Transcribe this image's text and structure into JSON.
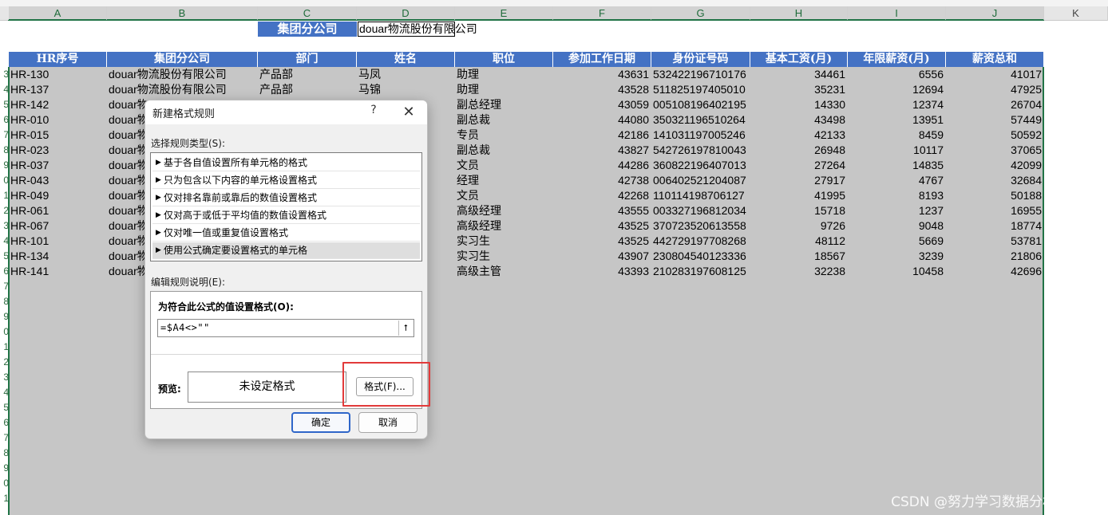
{
  "spreadsheet": {
    "columns": [
      "A",
      "B",
      "C",
      "D",
      "E",
      "F",
      "G",
      "H",
      "I",
      "J",
      "K"
    ],
    "selected_columns": [
      "A",
      "B",
      "C",
      "D",
      "E",
      "F",
      "G",
      "H",
      "I",
      "J"
    ],
    "row_numbers": [
      "3",
      "4",
      "5",
      "6",
      "7",
      "8",
      "9",
      "0",
      "1",
      "2",
      "3",
      "4",
      "5",
      "6",
      "7",
      "8",
      "9",
      "0",
      "1",
      "2",
      "3",
      "4",
      "5",
      "6",
      "7",
      "8",
      "9",
      "0",
      "1"
    ],
    "title_label": "集团分公司",
    "title_value": "douar物流股份有限公司",
    "headers": [
      "HR序号",
      "集团分公司",
      "部门",
      "姓名",
      "职位",
      "参加工作日期",
      "身份证号码",
      "基本工资(月)",
      "年限薪资(月)",
      "薪资总和"
    ],
    "rows": [
      {
        "hr": "HR-130",
        "company": "douar物流股份有限公司",
        "dept": "产品部",
        "name": "马凤",
        "position": "助理",
        "date": "43631",
        "id": "532422196710176",
        "base": "34461",
        "seniority": "6556",
        "total": "41017"
      },
      {
        "hr": "HR-137",
        "company": "douar物流股份有限公司",
        "dept": "产品部",
        "name": "马锦",
        "position": "助理",
        "date": "43528",
        "id": "511825197405010",
        "base": "35231",
        "seniority": "12694",
        "total": "47925"
      },
      {
        "hr": "HR-142",
        "company": "douar物",
        "dept": "",
        "name": "",
        "position": "副总经理",
        "date": "43059",
        "id": "005108196402195",
        "base": "14330",
        "seniority": "12374",
        "total": "26704"
      },
      {
        "hr": "HR-010",
        "company": "douar物",
        "dept": "",
        "name": "",
        "position": "副总裁",
        "date": "44080",
        "id": "350321196510264",
        "base": "43498",
        "seniority": "13951",
        "total": "57449"
      },
      {
        "hr": "HR-015",
        "company": "douar物",
        "dept": "",
        "name": "",
        "position": "专员",
        "date": "42186",
        "id": "141031197005246",
        "base": "42133",
        "seniority": "8459",
        "total": "50592"
      },
      {
        "hr": "HR-023",
        "company": "douar物",
        "dept": "",
        "name": "",
        "position": "副总裁",
        "date": "43827",
        "id": "542726197810043",
        "base": "26948",
        "seniority": "10117",
        "total": "37065"
      },
      {
        "hr": "HR-037",
        "company": "douar物",
        "dept": "",
        "name": "",
        "position": "文员",
        "date": "44286",
        "id": "360822196407013",
        "base": "27264",
        "seniority": "14835",
        "total": "42099"
      },
      {
        "hr": "HR-043",
        "company": "douar物",
        "dept": "",
        "name": "",
        "position": "经理",
        "date": "42738",
        "id": "006402521204087",
        "base": "27917",
        "seniority": "4767",
        "total": "32684"
      },
      {
        "hr": "HR-049",
        "company": "douar物",
        "dept": "",
        "name": "",
        "position": "文员",
        "date": "42268",
        "id": "110114198706127",
        "base": "41995",
        "seniority": "8193",
        "total": "50188"
      },
      {
        "hr": "HR-061",
        "company": "douar物",
        "dept": "",
        "name": "",
        "position": "高级经理",
        "date": "43555",
        "id": "003327196812034",
        "base": "15718",
        "seniority": "1237",
        "total": "16955"
      },
      {
        "hr": "HR-067",
        "company": "douar物",
        "dept": "",
        "name": "",
        "position": "高级经理",
        "date": "43525",
        "id": "370723520613558",
        "base": "9726",
        "seniority": "9048",
        "total": "18774"
      },
      {
        "hr": "HR-101",
        "company": "douar物",
        "dept": "",
        "name": "",
        "position": "实习生",
        "date": "43525",
        "id": "442729197708268",
        "base": "48112",
        "seniority": "5669",
        "total": "53781"
      },
      {
        "hr": "HR-134",
        "company": "douar物",
        "dept": "",
        "name": "",
        "position": "实习生",
        "date": "43907",
        "id": "230804540123336",
        "base": "18567",
        "seniority": "3239",
        "total": "21806"
      },
      {
        "hr": "HR-141",
        "company": "douar物",
        "dept": "",
        "name": "",
        "position": "高级主管",
        "date": "43393",
        "id": "210283197608125",
        "base": "32238",
        "seniority": "10458",
        "total": "42696"
      }
    ]
  },
  "dialog": {
    "title": "新建格式规则",
    "help_label": "?",
    "close_label": "✕",
    "rule_type_label": "选择规则类型(S):",
    "rule_types": [
      "基于各自值设置所有单元格的格式",
      "只为包含以下内容的单元格设置格式",
      "仅对排名靠前或靠后的数值设置格式",
      "仅对高于或低于平均值的数值设置格式",
      "仅对唯一值或重复值设置格式",
      "使用公式确定要设置格式的单元格"
    ],
    "selected_rule_index": 5,
    "edit_label": "编辑规则说明(E):",
    "formula_label": "为符合此公式的值设置格式(O):",
    "formula_value": "=$A4<>\"\"",
    "preview_label": "预览:",
    "preview_text": "未设定格式",
    "format_button": "格式(F)...",
    "ok_button": "确定",
    "cancel_button": "取消"
  },
  "watermark": "CSDN @努力学习数据分析的小江"
}
